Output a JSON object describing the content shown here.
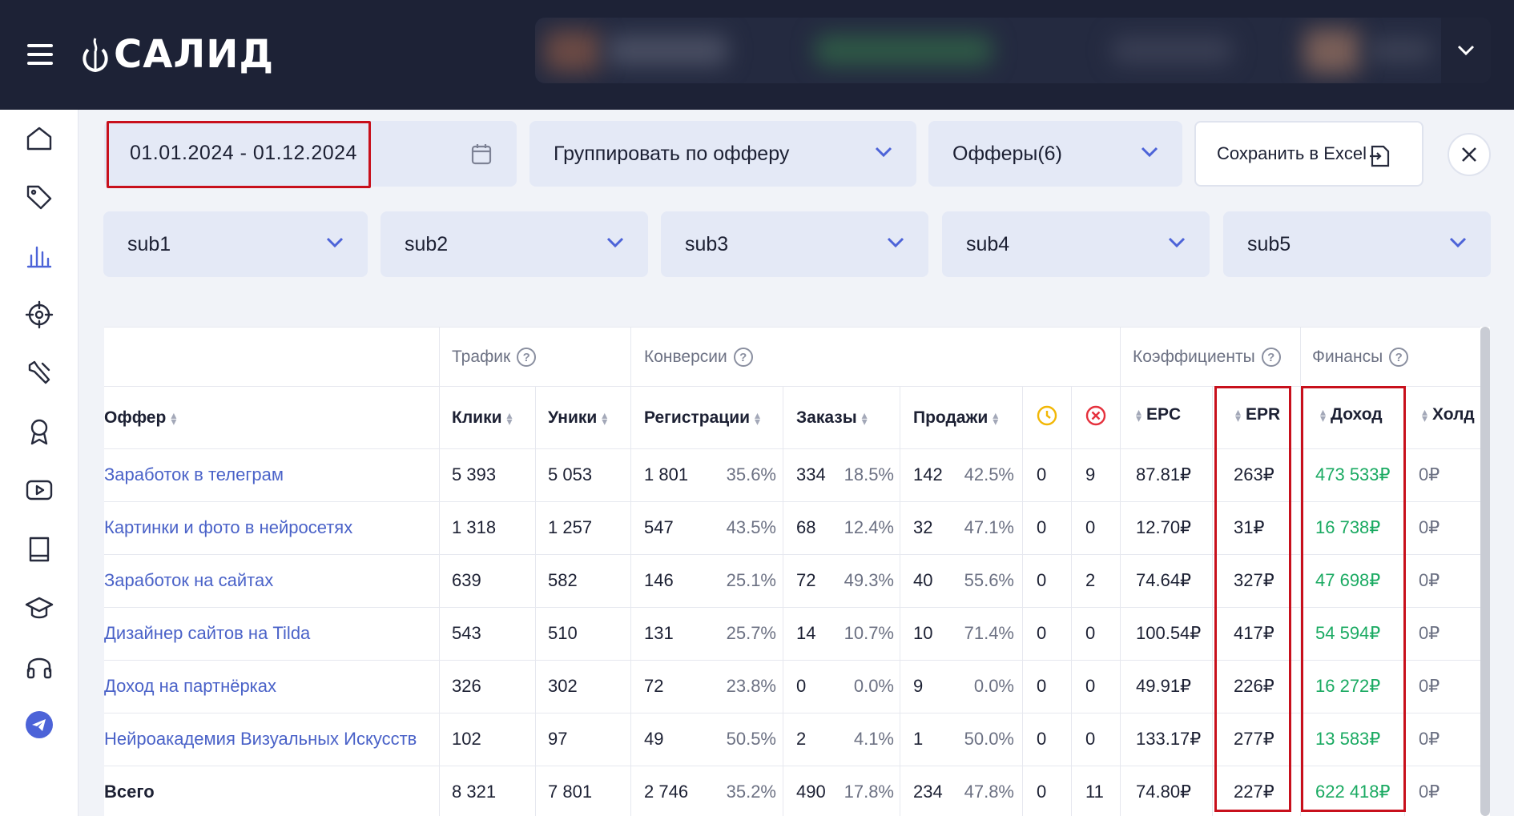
{
  "brand": {
    "logo_text": "САЛИД"
  },
  "filters": {
    "date_range": "01.01.2024 - 01.12.2024",
    "group_by": "Группировать по офферу",
    "offers": "Офферы(6)",
    "excel": "Сохранить в Excel",
    "subs": [
      "sub1",
      "sub2",
      "sub3",
      "sub4",
      "sub5"
    ]
  },
  "table": {
    "groups": {
      "traffic": "Трафик",
      "conversions": "Конверсии",
      "coefficients": "Коэффициенты",
      "finance": "Финансы"
    },
    "columns": {
      "offer": "Оффер",
      "clicks": "Клики",
      "uniques": "Уники",
      "registrations": "Регистрации",
      "orders": "Заказы",
      "sales": "Продажи",
      "epc": "EPC",
      "epr": "EPR",
      "income": "Доход",
      "hold": "Холд"
    },
    "rows": [
      {
        "offer": "Заработок в телеграм",
        "clicks": "5 393",
        "uniques": "5 053",
        "reg": "1 801",
        "reg_pct": "35.6%",
        "orders": "334",
        "orders_pct": "18.5%",
        "sales": "142",
        "sales_pct": "42.5%",
        "pending": "0",
        "rejected": "9",
        "epc": "87.81₽",
        "epr": "263₽",
        "income": "473 533₽",
        "hold": "0₽"
      },
      {
        "offer": "Картинки и фото в нейросетях",
        "clicks": "1 318",
        "uniques": "1 257",
        "reg": "547",
        "reg_pct": "43.5%",
        "orders": "68",
        "orders_pct": "12.4%",
        "sales": "32",
        "sales_pct": "47.1%",
        "pending": "0",
        "rejected": "0",
        "epc": "12.70₽",
        "epr": "31₽",
        "income": "16 738₽",
        "hold": "0₽"
      },
      {
        "offer": "Заработок на сайтах",
        "clicks": "639",
        "uniques": "582",
        "reg": "146",
        "reg_pct": "25.1%",
        "orders": "72",
        "orders_pct": "49.3%",
        "sales": "40",
        "sales_pct": "55.6%",
        "pending": "0",
        "rejected": "2",
        "epc": "74.64₽",
        "epr": "327₽",
        "income": "47 698₽",
        "hold": "0₽"
      },
      {
        "offer": "Дизайнер сайтов на Tilda",
        "clicks": "543",
        "uniques": "510",
        "reg": "131",
        "reg_pct": "25.7%",
        "orders": "14",
        "orders_pct": "10.7%",
        "sales": "10",
        "sales_pct": "71.4%",
        "pending": "0",
        "rejected": "0",
        "epc": "100.54₽",
        "epr": "417₽",
        "income": "54 594₽",
        "hold": "0₽"
      },
      {
        "offer": "Доход на партнёрках",
        "clicks": "326",
        "uniques": "302",
        "reg": "72",
        "reg_pct": "23.8%",
        "orders": "0",
        "orders_pct": "0.0%",
        "sales": "9",
        "sales_pct": "0.0%",
        "pending": "0",
        "rejected": "0",
        "epc": "49.91₽",
        "epr": "226₽",
        "income": "16 272₽",
        "hold": "0₽"
      },
      {
        "offer": "Нейроакадемия Визуальных Искусств",
        "clicks": "102",
        "uniques": "97",
        "reg": "49",
        "reg_pct": "50.5%",
        "orders": "2",
        "orders_pct": "4.1%",
        "sales": "1",
        "sales_pct": "50.0%",
        "pending": "0",
        "rejected": "0",
        "epc": "133.17₽",
        "epr": "277₽",
        "income": "13 583₽",
        "hold": "0₽"
      }
    ],
    "total": {
      "offer": "Всего",
      "clicks": "8 321",
      "uniques": "7 801",
      "reg": "2 746",
      "reg_pct": "35.2%",
      "orders": "490",
      "orders_pct": "17.8%",
      "sales": "234",
      "sales_pct": "47.8%",
      "pending": "0",
      "rejected": "11",
      "epc": "74.80₽",
      "epr": "227₽",
      "income": "622 418₽",
      "hold": "0₽"
    }
  },
  "colors": {
    "header_bg": "#1d2236",
    "accent": "#4c63d8",
    "link": "#4a62c8",
    "income_green": "#1aaa62",
    "highlight_red": "#c8101c"
  }
}
